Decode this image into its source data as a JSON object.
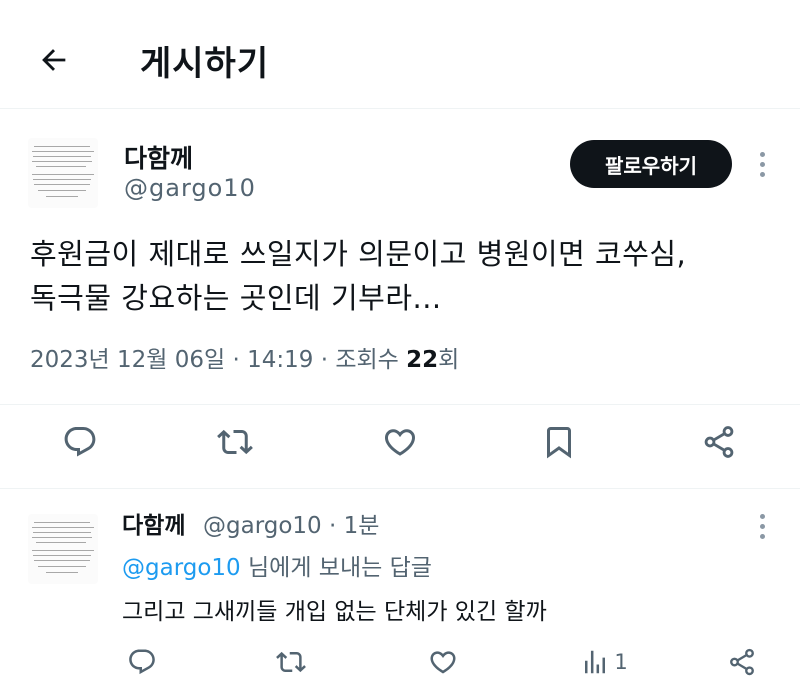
{
  "header": {
    "title": "게시하기",
    "back_icon": "arrow-left-icon"
  },
  "tweet": {
    "author_name": "다함께",
    "author_handle": "@gargo10",
    "follow_label": "팔로우하기",
    "text_line1": "후원금이 제대로 쓰일지가 의문이고 병원이면 코쑤심,",
    "text_line2": "독극물 강요하는 곳인데 기부라...",
    "meta_prefix": "2023년 12월 06일 · 14:19 · 조회수 ",
    "views": "22",
    "views_suffix": "회",
    "actions": [
      "reply-icon",
      "retweet-icon",
      "like-icon",
      "bookmark-icon",
      "share-icon"
    ]
  },
  "reply": {
    "author_name": "다함께",
    "handle_time": "@gargo10 · 1분",
    "mention": "@gargo10",
    "replying_suffix": " 님에게 보내는 답글",
    "text": "그리고 그새끼들 개입 없는 단체가 있긴 할까",
    "views_count": "1",
    "actions": [
      "reply-icon",
      "retweet-icon",
      "like-icon",
      "views-icon",
      "share-icon"
    ]
  },
  "colors": {
    "text": "#0f1419",
    "secondary": "#536471",
    "link": "#1d9bf0",
    "button_bg": "#0f1419"
  }
}
